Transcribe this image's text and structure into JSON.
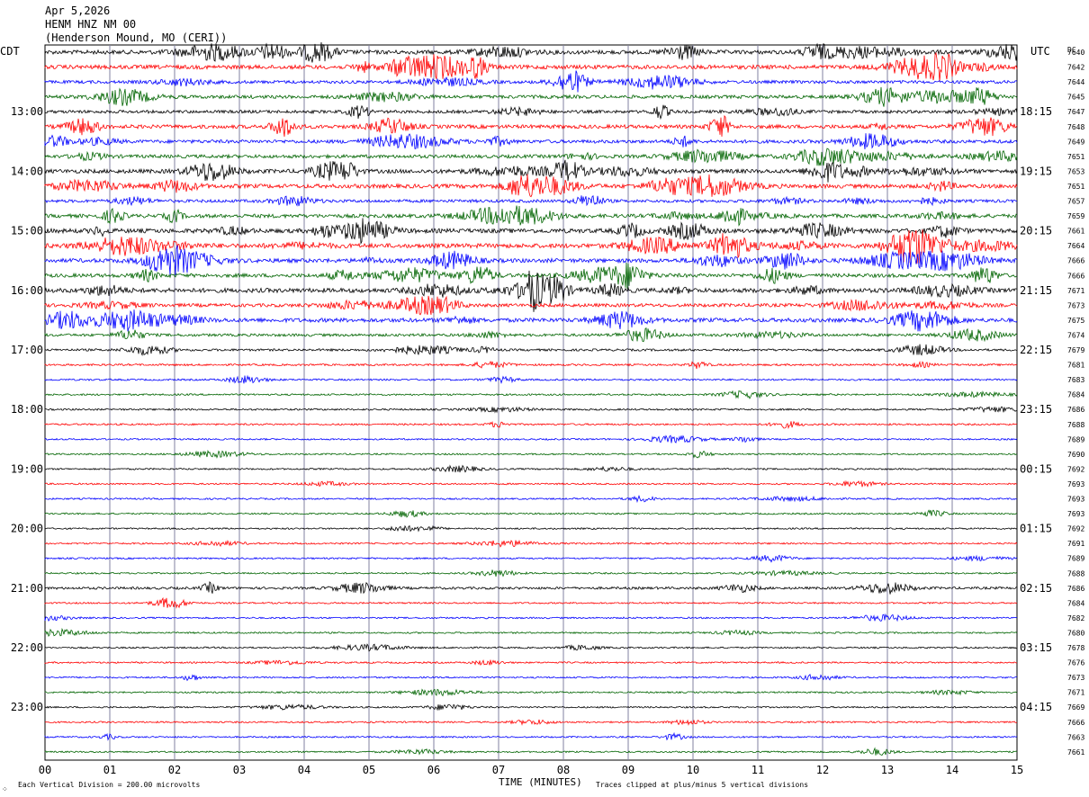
{
  "header": {
    "date": "Apr 5,2026",
    "station": "HENM HNZ NM 00",
    "location": "(Henderson Mound, MO (CERI))"
  },
  "left_tz": "CDT",
  "right_tz": "UTC",
  "dc_label": "DC",
  "footer": {
    "scale": "Each Vertical Division =  200.00 microvolts",
    "xlabel": "TIME (MINUTES)",
    "clip_note": "Traces clipped at plus/minus 5 vertical divisions",
    "corner_mark": "⁘"
  },
  "colors": {
    "black": "#000000",
    "red": "#ff0000",
    "blue": "#0000ff",
    "green": "#006400",
    "grid": "#8080a0"
  },
  "chart_data": {
    "type": "helicorder",
    "x_ticks": [
      "00",
      "01",
      "02",
      "03",
      "04",
      "05",
      "06",
      "07",
      "08",
      "09",
      "10",
      "11",
      "12",
      "13",
      "14",
      "15"
    ],
    "xlim": [
      0,
      15
    ],
    "xlabel": "TIME (MINUTES)",
    "trace_colors": [
      "black",
      "red",
      "blue",
      "green"
    ],
    "left_hour_labels": [
      "13:00",
      "14:00",
      "15:00",
      "16:00",
      "17:00",
      "18:00",
      "19:00",
      "20:00",
      "21:00",
      "22:00",
      "23:00"
    ],
    "right_hour_labels": [
      "18:15",
      "19:15",
      "20:15",
      "21:15",
      "22:15",
      "23:15",
      "00:15",
      "01:15",
      "02:15",
      "03:15",
      "04:15"
    ],
    "first_labeled_line": 4,
    "dc_offsets": [
      7640,
      7642,
      7644,
      7645,
      7647,
      7648,
      7649,
      7651,
      7653,
      7651,
      7657,
      7659,
      7661,
      7664,
      7666,
      7666,
      7671,
      7673,
      7675,
      7674,
      7679,
      7681,
      7683,
      7684,
      7686,
      7688,
      7689,
      7690,
      7692,
      7693,
      7693,
      7693,
      7692,
      7691,
      7689,
      7688,
      7686,
      7684,
      7682,
      7680,
      7678,
      7676,
      7673,
      7671,
      7669,
      7666,
      7663,
      7661
    ],
    "line_activity": [
      0.9,
      0.9,
      0.6,
      0.7,
      0.6,
      0.8,
      0.7,
      0.7,
      0.9,
      0.9,
      0.6,
      0.8,
      1.0,
      1.0,
      0.9,
      0.8,
      1.0,
      0.7,
      0.9,
      0.5,
      0.35,
      0.25,
      0.2,
      0.2,
      0.2,
      0.2,
      0.15,
      0.15,
      0.15,
      0.15,
      0.15,
      0.15,
      0.15,
      0.15,
      0.15,
      0.15,
      0.4,
      0.15,
      0.15,
      0.15,
      0.15,
      0.15,
      0.15,
      0.15,
      0.15,
      0.15,
      0.15,
      0.15
    ]
  }
}
